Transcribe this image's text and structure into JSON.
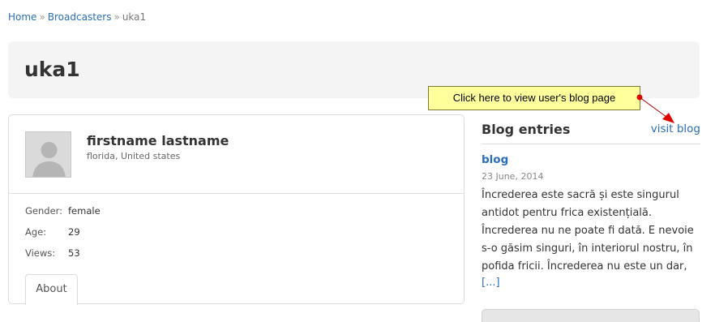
{
  "breadcrumb": {
    "home": "Home",
    "separator": "»",
    "broadcasters": "Broadcasters",
    "current": "uka1"
  },
  "page": {
    "title": "uka1"
  },
  "profile": {
    "name": "firstname lastname",
    "location": "florida, United states",
    "fields": [
      {
        "label": "Gender:",
        "value": "female"
      },
      {
        "label": "Age:",
        "value": "29"
      },
      {
        "label": "Views:",
        "value": "53"
      }
    ],
    "tab_about": "About"
  },
  "blog": {
    "heading": "Blog entries",
    "visit_link": "visit blog",
    "entry": {
      "title": "blog",
      "date": "23 June, 2014",
      "excerpt": "Încrederea este sacră și este singurul antidot pentru frica existențială. Încrederea nu ne poate fi dată. E nevoie s-o găsim singuri, în interiorul nostru, în pofida fricii. Încrederea nu este un dar,",
      "more": "[...]"
    }
  },
  "annotation": {
    "callout_text": "Click here to view user's blog page"
  },
  "colors": {
    "link": "#2a6ebb",
    "title_bar_bg": "#f4f4f4",
    "callout_bg": "#ffff9c",
    "arrow": "#e00000"
  },
  "icons": {
    "avatar": "default-user-silhouette-icon"
  }
}
